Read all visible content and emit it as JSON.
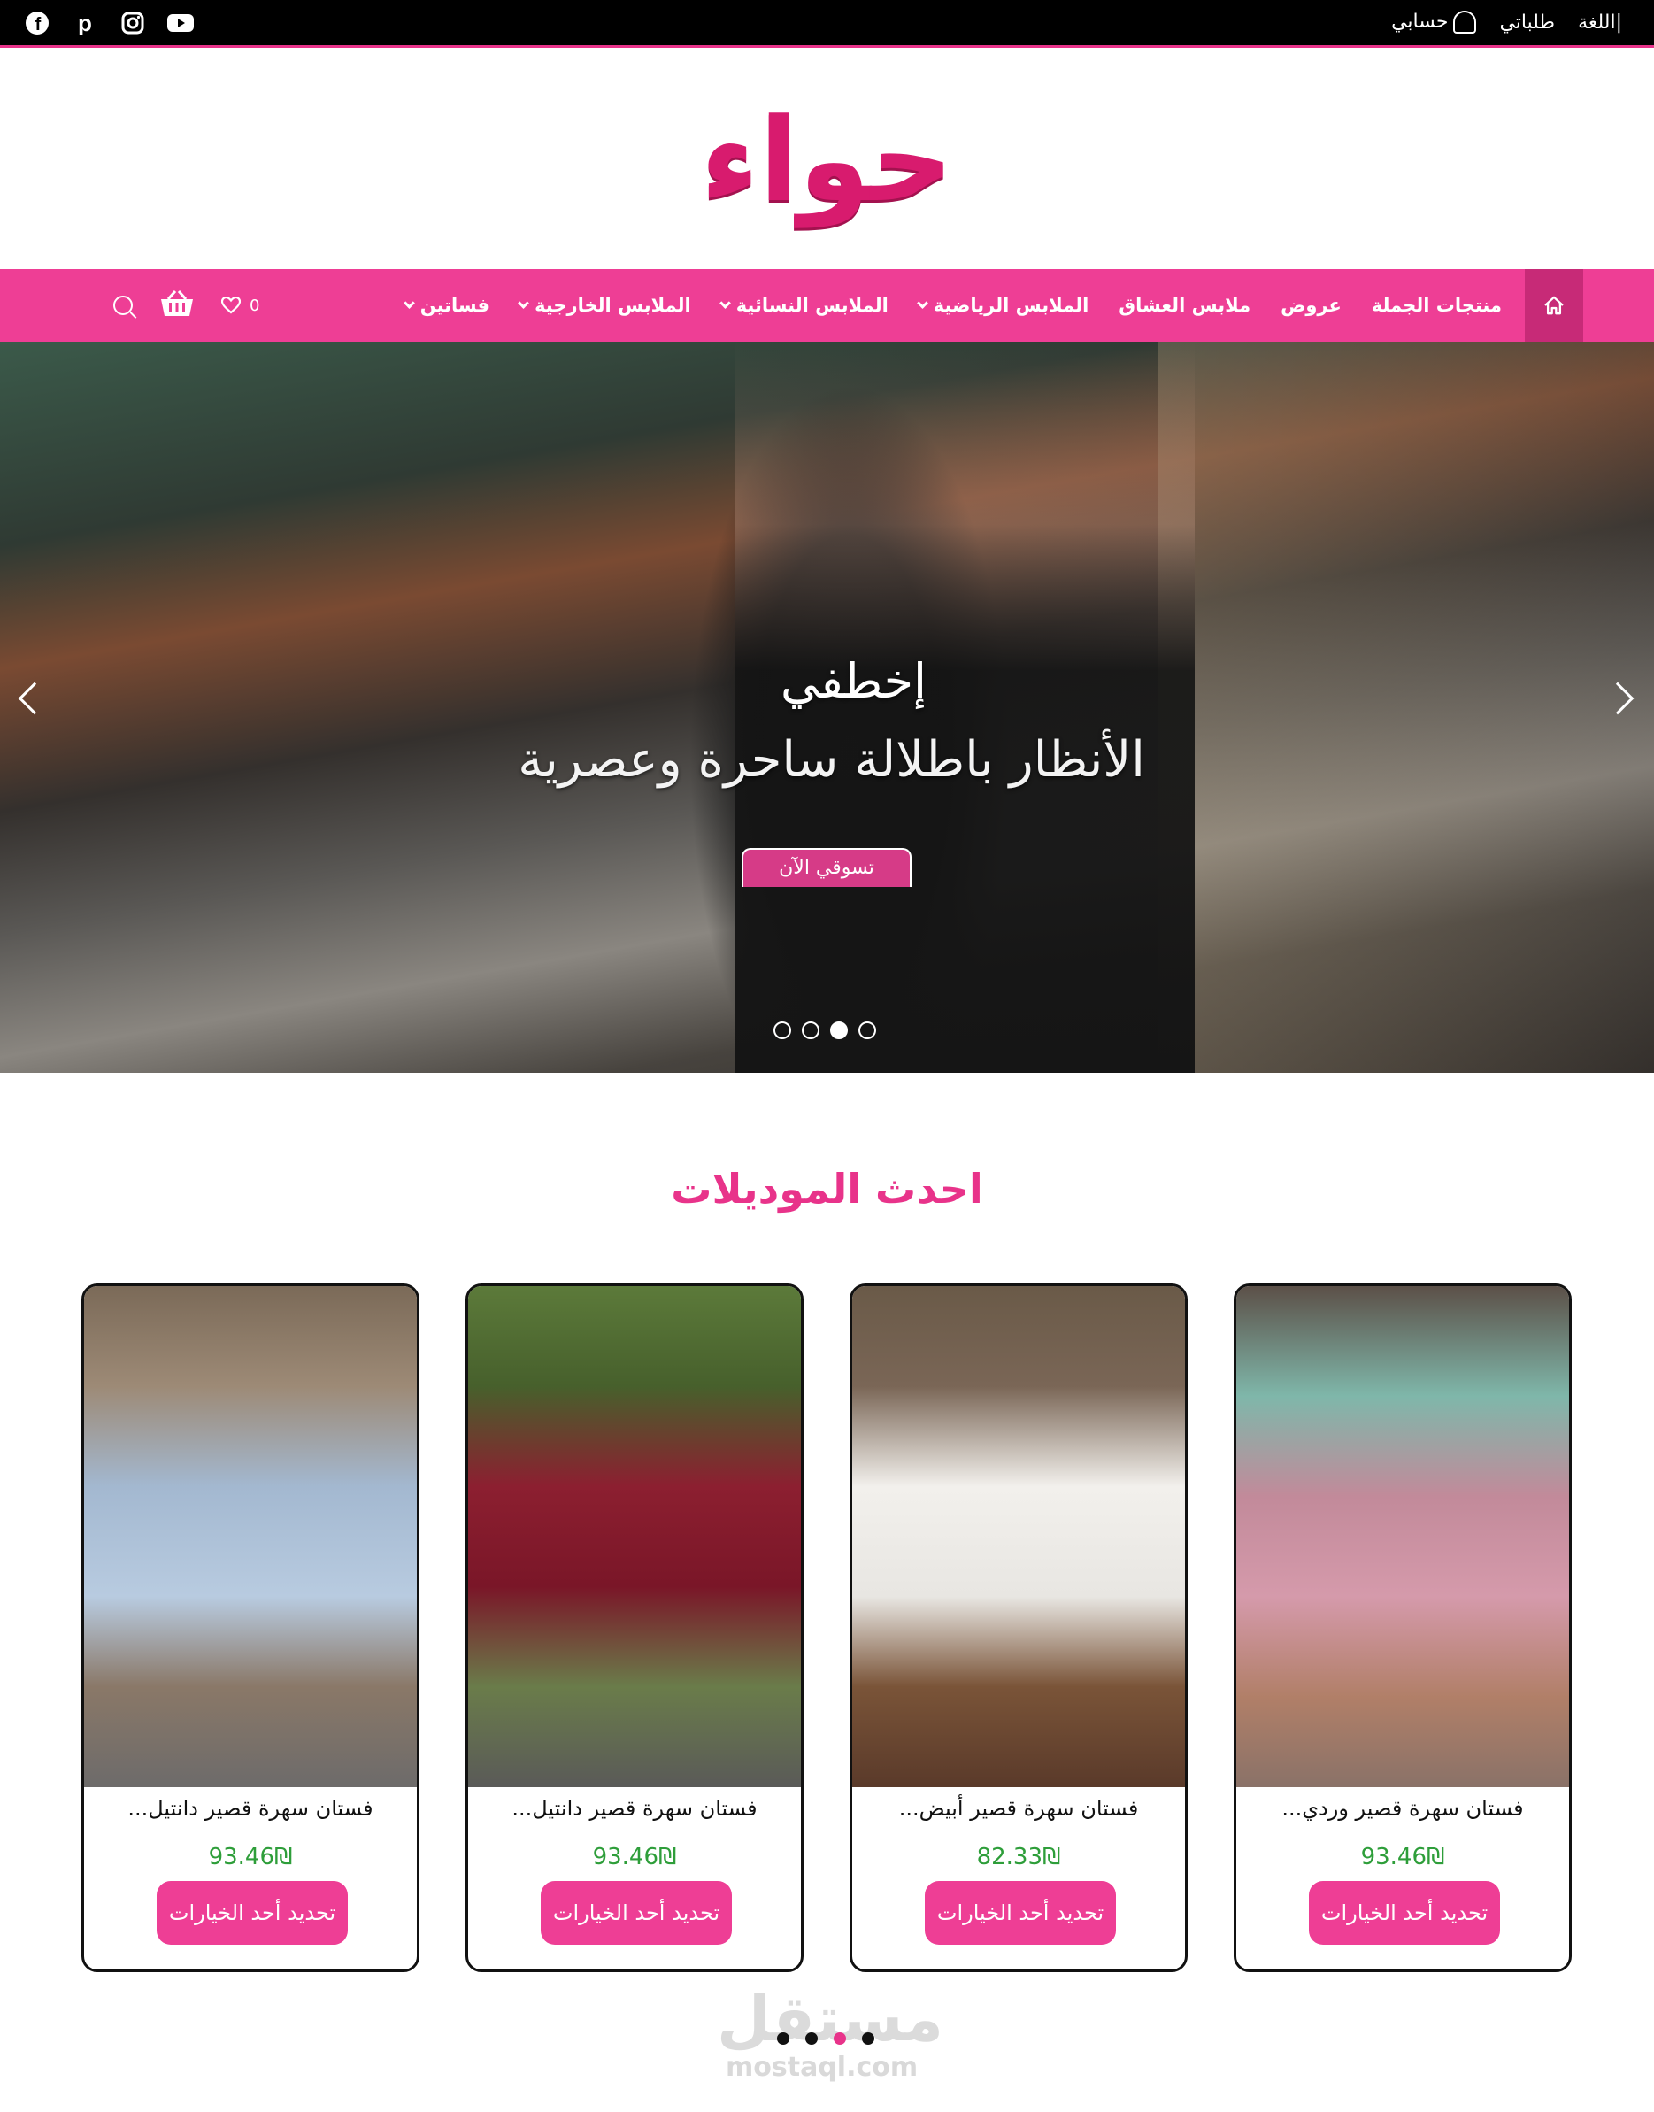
{
  "topbar": {
    "account": "حسابي",
    "orders": "طلباتي",
    "language": "اللغة",
    "separator": "|",
    "socials": [
      "youtube-icon",
      "instagram-icon",
      "pinterest-icon",
      "facebook-icon"
    ]
  },
  "logo": {
    "text": "حواء"
  },
  "nav": {
    "items": [
      {
        "label": "فساتين",
        "dropdown": true
      },
      {
        "label": "الملابس الخارجية",
        "dropdown": true
      },
      {
        "label": "الملابس النسائية",
        "dropdown": true
      },
      {
        "label": "الملابس الرياضية",
        "dropdown": true
      },
      {
        "label": "ملابس العشاق",
        "dropdown": false
      },
      {
        "label": "عروض",
        "dropdown": false
      },
      {
        "label": "منتجات الجملة",
        "dropdown": false
      }
    ],
    "wishlist_count": "0"
  },
  "hero": {
    "title_line1": "إخطفي",
    "title_line2": "الأنظار باطلالة ساحرة وعصرية",
    "cta": "تسوقي الآن",
    "slides": 4,
    "active_slide": 3
  },
  "section": {
    "title": "احدث الموديلات"
  },
  "products": [
    {
      "name": "فستان سهرة قصير دانتيل...",
      "price": "93.46₪",
      "button": "تحديد أحد الخيارات"
    },
    {
      "name": "فستان سهرة قصير دانتيل...",
      "price": "93.46₪",
      "button": "تحديد أحد الخيارات"
    },
    {
      "name": "فستان سهرة قصير أبيض...",
      "price": "82.33₪",
      "button": "تحديد أحد الخيارات"
    },
    {
      "name": "فستان سهرة قصير وردي...",
      "price": "93.46₪",
      "button": "تحديد أحد الخيارات"
    }
  ],
  "carousel": {
    "dots": 4,
    "active": 3
  },
  "watermark": {
    "main": "مستقل",
    "sub": "mostaql.com"
  },
  "colors": {
    "brand_pink": "#ee3e95",
    "logo_pink": "#d81b6e",
    "price_green": "#2e9e3a"
  }
}
